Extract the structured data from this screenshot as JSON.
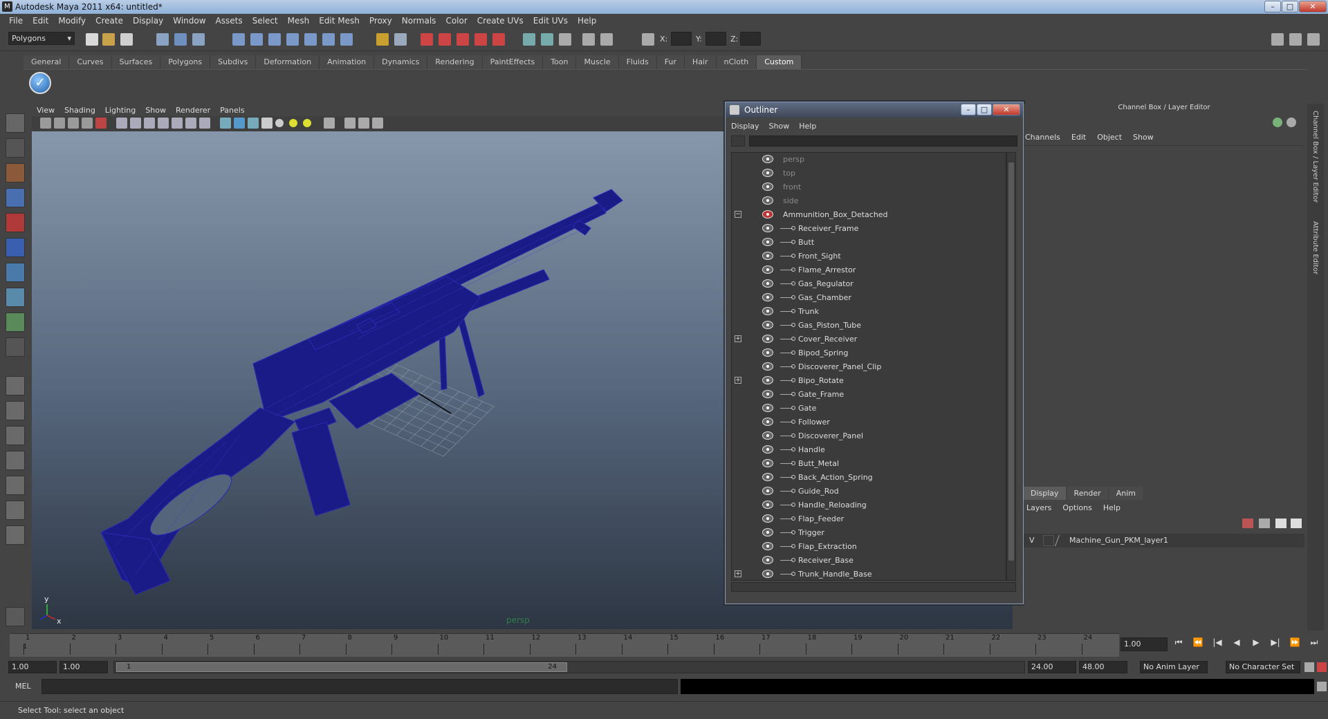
{
  "window": {
    "title": "Autodesk Maya 2011 x64: untitled*",
    "app_icon": "M",
    "btn_min": "–",
    "btn_max": "□",
    "btn_close": "✕"
  },
  "menubar": [
    "File",
    "Edit",
    "Modify",
    "Create",
    "Display",
    "Window",
    "Assets",
    "Select",
    "Mesh",
    "Edit Mesh",
    "Proxy",
    "Normals",
    "Color",
    "Create UVs",
    "Edit UVs",
    "Help"
  ],
  "statusline": {
    "mode": "Polygons",
    "x_label": "X:",
    "y_label": "Y:",
    "z_label": "Z:"
  },
  "shelf": {
    "tabs": [
      "General",
      "Curves",
      "Surfaces",
      "Polygons",
      "Subdivs",
      "Deformation",
      "Animation",
      "Dynamics",
      "Rendering",
      "PaintEffects",
      "Toon",
      "Muscle",
      "Fluids",
      "Fur",
      "Hair",
      "nCloth",
      "Custom"
    ],
    "active_tab": "Custom",
    "check_glyph": "✓"
  },
  "viewport": {
    "menu": [
      "View",
      "Shading",
      "Lighting",
      "Show",
      "Renderer",
      "Panels"
    ],
    "camera_label": "persp",
    "axis_x": "x",
    "axis_y": "y",
    "wire_color": "#1a1a8c"
  },
  "outliner": {
    "title": "Outliner",
    "menu": [
      "Display",
      "Show",
      "Help"
    ],
    "cameras": [
      "persp",
      "top",
      "front",
      "side"
    ],
    "group": "Ammunition_Box_Detached",
    "collapse_glyph": "−",
    "expand_glyph": "+",
    "items": [
      {
        "name": "Receiver_Frame",
        "expandable": false
      },
      {
        "name": "Butt",
        "expandable": false
      },
      {
        "name": "Front_Sight",
        "expandable": false
      },
      {
        "name": "Flame_Arrestor",
        "expandable": false
      },
      {
        "name": "Gas_Regulator",
        "expandable": false
      },
      {
        "name": "Gas_Chamber",
        "expandable": false
      },
      {
        "name": "Trunk",
        "expandable": false
      },
      {
        "name": "Gas_Piston_Tube",
        "expandable": false
      },
      {
        "name": "Cover_Receiver",
        "expandable": true
      },
      {
        "name": "Bipod_Spring",
        "expandable": false
      },
      {
        "name": "Discoverer_Panel_Clip",
        "expandable": false
      },
      {
        "name": "Bipo_Rotate",
        "expandable": true
      },
      {
        "name": "Gate_Frame",
        "expandable": false
      },
      {
        "name": "Gate",
        "expandable": false
      },
      {
        "name": "Follower",
        "expandable": false
      },
      {
        "name": "Discoverer_Panel",
        "expandable": false
      },
      {
        "name": "Handle",
        "expandable": false
      },
      {
        "name": "Butt_Metal",
        "expandable": false
      },
      {
        "name": "Back_Action_Spring",
        "expandable": false
      },
      {
        "name": "Guide_Rod",
        "expandable": false
      },
      {
        "name": "Handle_Reloading",
        "expandable": false
      },
      {
        "name": "Flap_Feeder",
        "expandable": false
      },
      {
        "name": "Trigger",
        "expandable": false
      },
      {
        "name": "Flap_Extraction",
        "expandable": false
      },
      {
        "name": "Receiver_Base",
        "expandable": false
      },
      {
        "name": "Trunk_Handle_Base",
        "expandable": true
      }
    ]
  },
  "channelbox": {
    "header": "Channel Box / Layer Editor",
    "menu": [
      "Channels",
      "Edit",
      "Object",
      "Show"
    ],
    "side_tabs": [
      "Channel Box / Layer Editor",
      "Attribute Editor"
    ],
    "layer_tabs": [
      "Display",
      "Render",
      "Anim"
    ],
    "active_layer_tab": "Display",
    "layer_menu": [
      "Layers",
      "Options",
      "Help"
    ],
    "layer": {
      "visible": "V",
      "name": "Machine_Gun_PKM_layer1"
    }
  },
  "timeline": {
    "ticks": [
      1,
      2,
      3,
      4,
      5,
      6,
      7,
      8,
      9,
      10,
      11,
      12,
      13,
      14,
      15,
      16,
      17,
      18,
      19,
      20,
      21,
      22,
      23,
      24
    ],
    "current_frame_marker": "1",
    "current_time": "1.00",
    "play_buttons": [
      "⏮",
      "⏪",
      "|◀",
      "◀",
      "▶",
      "▶|",
      "⏩",
      "⏭"
    ]
  },
  "range": {
    "start_time": "1.00",
    "playback_start": "1.00",
    "range_start_label": "1",
    "range_end_label": "24",
    "playback_end": "24.00",
    "end_time": "48.00",
    "anim_layer": "No Anim Layer",
    "character_set": "No Character Set"
  },
  "commandline": {
    "label": "MEL"
  },
  "helpline": {
    "text": "Select Tool: select an object"
  }
}
